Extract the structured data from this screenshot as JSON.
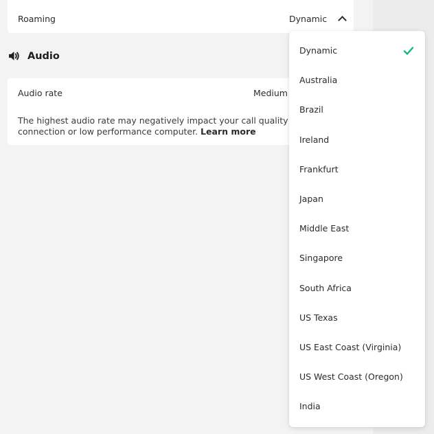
{
  "roaming": {
    "label": "Roaming",
    "selected": "Dynamic",
    "chevron_icon": "chevron-up-icon"
  },
  "audio_section": {
    "title": "Audio",
    "icon": "speaker-icon",
    "rate_label": "Audio rate",
    "rate_value": "Medium (",
    "description": "The highest audio rate may negatively impact your call quality on a p",
    "description_line2": "connection or low performance computer.",
    "learn_more": "Learn more"
  },
  "dropdown": {
    "options": [
      {
        "label": "Dynamic",
        "selected": true
      },
      {
        "label": "Australia",
        "selected": false
      },
      {
        "label": "Brazil",
        "selected": false
      },
      {
        "label": "Ireland",
        "selected": false
      },
      {
        "label": "Frankfurt",
        "selected": false
      },
      {
        "label": "Japan",
        "selected": false
      },
      {
        "label": "Middle East",
        "selected": false
      },
      {
        "label": "Singapore",
        "selected": false
      },
      {
        "label": "South Africa",
        "selected": false
      },
      {
        "label": "US Texas",
        "selected": false
      },
      {
        "label": "US East Coast (Virginia)",
        "selected": false
      },
      {
        "label": "US West Coast (Oregon)",
        "selected": false
      },
      {
        "label": "India",
        "selected": false
      }
    ],
    "check_icon": "check-icon",
    "check_color": "#16b47f"
  },
  "colors": {
    "background": "#f3f3f3",
    "card": "#ffffff",
    "text": "#2b2b2b"
  }
}
